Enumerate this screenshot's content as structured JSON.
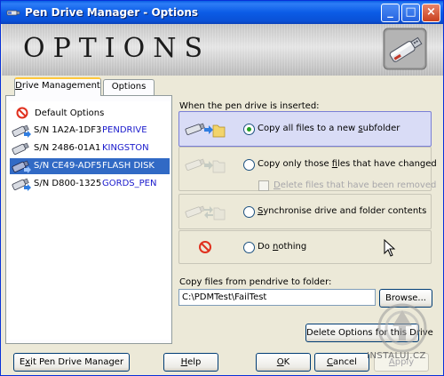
{
  "window": {
    "title": "Pen Drive Manager - Options",
    "controls": {
      "minimize": "_",
      "maximize": "□",
      "close": "×"
    }
  },
  "banner": {
    "heading": "OPTIONS",
    "logo_icon": "usb-pen-drive-icon"
  },
  "tabs": [
    {
      "label": "Drive Management",
      "accel": "D",
      "rest": "rive Management",
      "active": true
    },
    {
      "label": "Options",
      "active": false
    }
  ],
  "drive_list": {
    "default_option": {
      "label": "Default Options",
      "icon": "no-entry-icon"
    },
    "drives": [
      {
        "serial": "S/N 1A2A-1DF3",
        "name": "PENDRIVE",
        "selected": false
      },
      {
        "serial": "S/N 2486-01A1",
        "name": "KINGSTON",
        "selected": false
      },
      {
        "serial": "S/N CE49-ADF5",
        "name": "FLASH DISK",
        "selected": true
      },
      {
        "serial": "S/N D800-1325",
        "name": "GORDS_PEN",
        "selected": false
      }
    ]
  },
  "options": {
    "when_label": "When the pen drive is inserted:",
    "choices": [
      {
        "label": "Copy all files to a new subfolder",
        "pre": "Copy all files to a new ",
        "accel": "s",
        "post": "ubfolder",
        "selected": true
      },
      {
        "label": "Copy only those files that have changed",
        "pre": "Copy only those ",
        "accel": "f",
        "post": "iles that have changed",
        "selected": false
      },
      {
        "label": "Synchronise drive and folder contents",
        "pre": "",
        "accel": "S",
        "post": "ynchronise drive and folder contents",
        "selected": false
      },
      {
        "label": "Do nothing",
        "pre": "Do ",
        "accel": "n",
        "post": "othing",
        "selected": false
      }
    ],
    "delete_checkbox": {
      "label": "Delete files that have been removed",
      "accel": "D",
      "rest": "elete files that have been removed",
      "checked": false,
      "enabled": false
    }
  },
  "copy_folder": {
    "label": "Copy files from pendrive to folder:",
    "value": "C:\\PDMTest\\FailTest"
  },
  "buttons": {
    "browse": "Browse...",
    "delete_options": "Delete Options for this Drive",
    "exit": {
      "label": "Exit Pen Drive Manager",
      "accel": "x",
      "pre": "E",
      "post": "it Pen Drive Manager"
    },
    "help": {
      "label": "Help",
      "accel": "H",
      "post": "elp"
    },
    "ok": {
      "label": "OK",
      "accel": "O",
      "post": "K"
    },
    "cancel": {
      "label": "Cancel",
      "accel": "C",
      "post": "ancel"
    },
    "apply": {
      "label": "Apply",
      "accel": "A",
      "post": "pply",
      "enabled": false
    }
  },
  "watermark": {
    "text": "INSTALUJ.CZ"
  },
  "colors": {
    "title_bar": "#0b5ce6",
    "selection": "#316ac5",
    "drive_name": "#1a1acc",
    "selected_option_bg": "#d9dcf6",
    "tab_highlight": "#ffc83c"
  }
}
